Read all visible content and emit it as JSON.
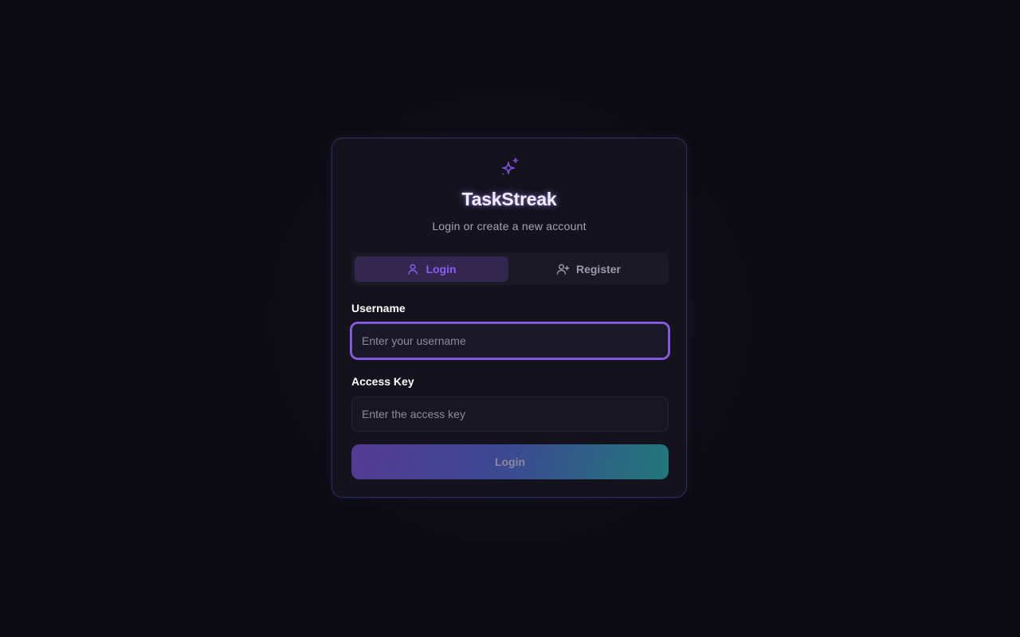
{
  "app": {
    "title": "TaskStreak",
    "subtitle": "Login or create a new account",
    "logo_icon": "sparkles-icon"
  },
  "tabs": [
    {
      "label": "Login",
      "icon": "user-icon",
      "active": true
    },
    {
      "label": "Register",
      "icon": "user-plus-icon",
      "active": false
    }
  ],
  "form": {
    "username": {
      "label": "Username",
      "placeholder": "Enter your username",
      "value": ""
    },
    "access_key": {
      "label": "Access Key",
      "placeholder": "Enter the access key",
      "value": ""
    },
    "submit_label": "Login"
  },
  "colors": {
    "accent": "#8a5cf6",
    "background": "#0c0b13",
    "card": "#14121c",
    "gradient_start": "#543a94",
    "gradient_end": "#21787a"
  }
}
